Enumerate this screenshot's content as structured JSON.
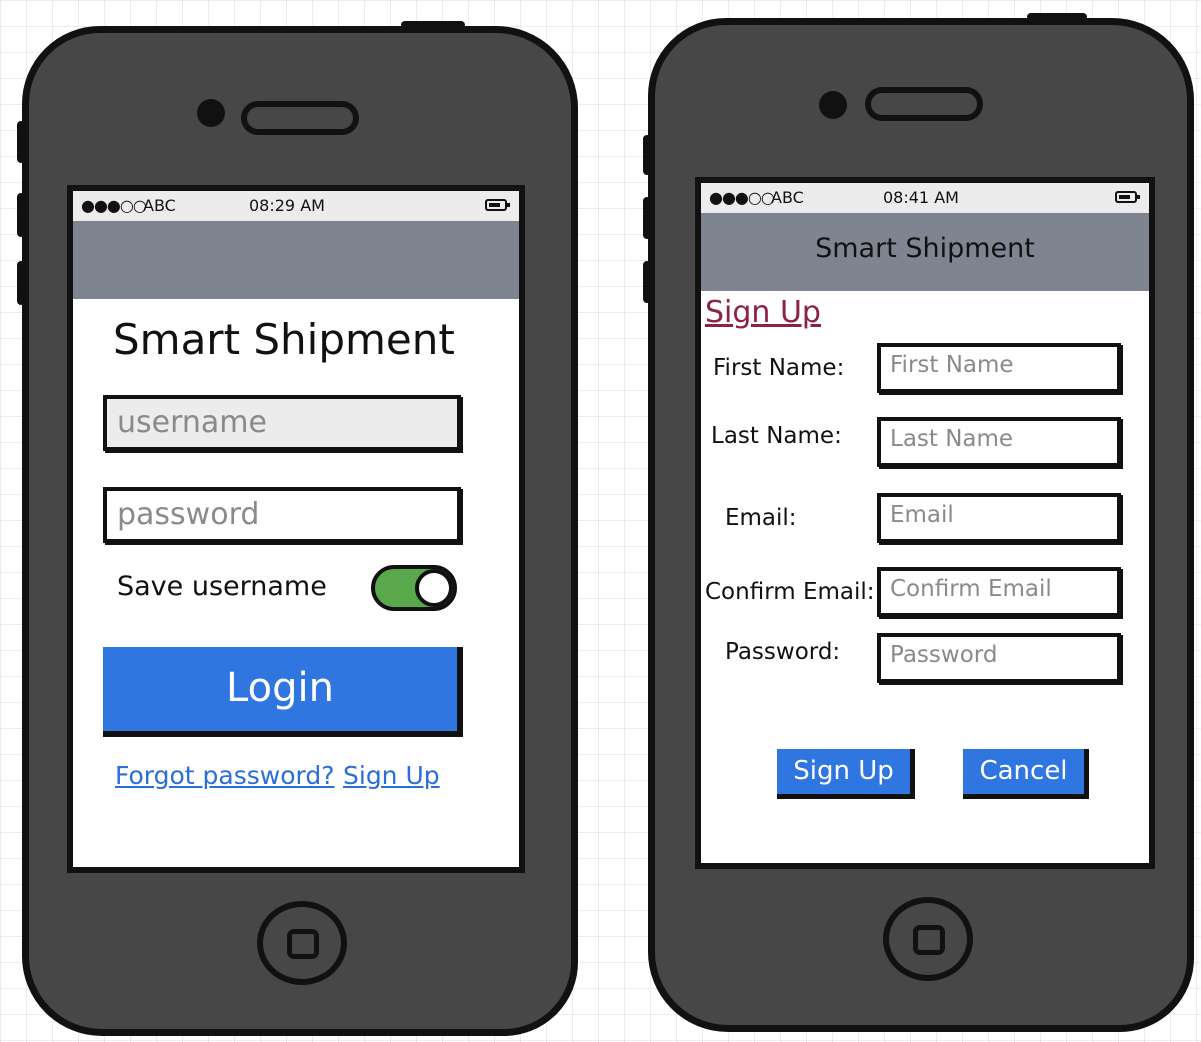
{
  "login_screen": {
    "status": {
      "signal": "●●●○○",
      "carrier": "ABC",
      "time": "08:29 AM"
    },
    "app_title": "Smart Shipment",
    "username_placeholder": "username",
    "password_placeholder": "password",
    "save_username_label": "Save username",
    "save_username_on": true,
    "login_label": "Login",
    "forgot_password_label": "Forgot password?",
    "sign_up_link": "Sign Up"
  },
  "signup_screen": {
    "status": {
      "signal": "●●●○○",
      "carrier": "ABC",
      "time": "08:41 AM"
    },
    "nav_title": "Smart Shipment",
    "heading": "Sign Up",
    "fields": [
      {
        "label": "First Name:",
        "placeholder": "First Name"
      },
      {
        "label": "Last Name:",
        "placeholder": "Last Name"
      },
      {
        "label": "Email:",
        "placeholder": "Email"
      },
      {
        "label": "Confirm Email:",
        "placeholder": "Confirm Email"
      },
      {
        "label": "Password:",
        "placeholder": "Password"
      }
    ],
    "sign_up_button": "Sign Up",
    "cancel_button": "Cancel"
  },
  "colors": {
    "phone_body": "#474747",
    "nav_bar": "#7f8590",
    "primary_button": "#2f76e0",
    "toggle_on": "#5aa84c",
    "link": "#2a6ed8",
    "signup_heading": "#8e2144"
  }
}
